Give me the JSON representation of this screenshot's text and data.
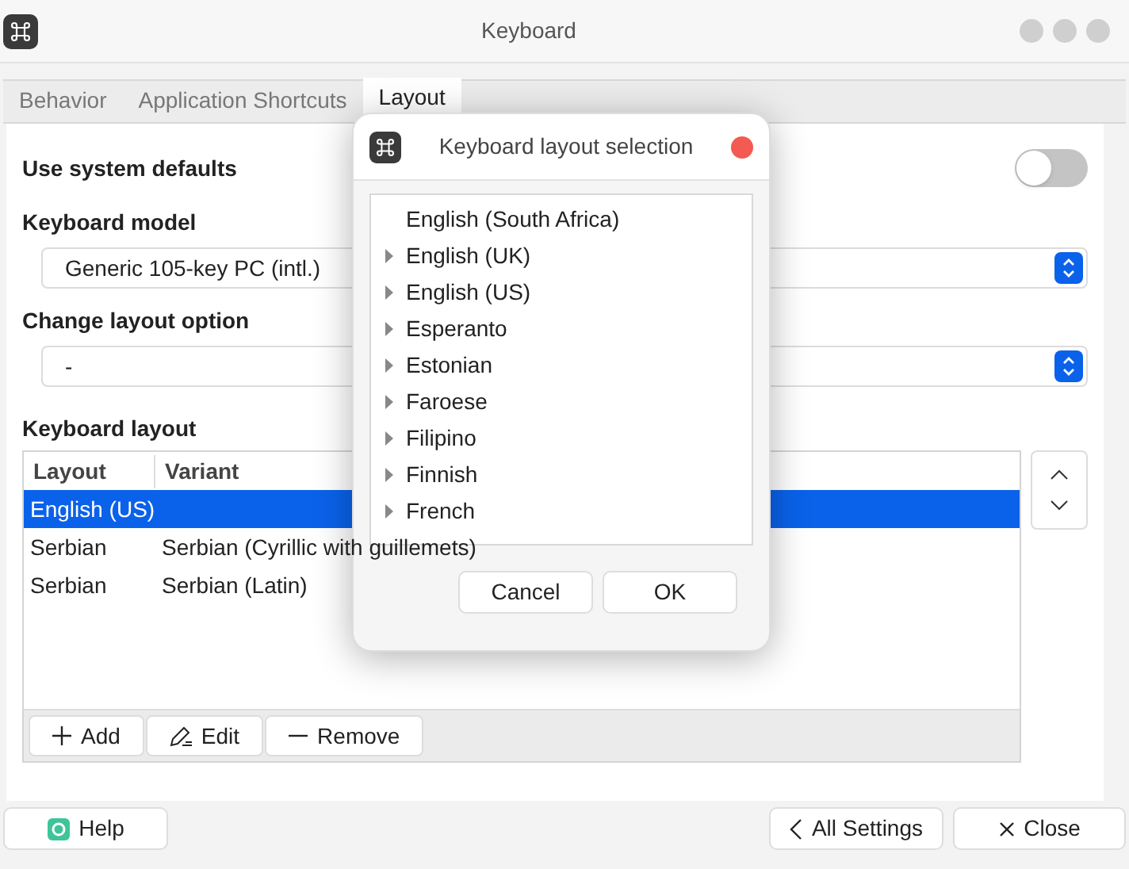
{
  "window": {
    "title": "Keyboard"
  },
  "tabs": [
    {
      "label": "Behavior",
      "selected": false
    },
    {
      "label": "Application Shortcuts",
      "selected": false
    },
    {
      "label": "Layout",
      "selected": true
    }
  ],
  "system_defaults": {
    "label": "Use system defaults",
    "on": false
  },
  "keyboard_model": {
    "label": "Keyboard model",
    "value": "Generic 105-key PC (intl.)"
  },
  "layout_option": {
    "label": "Change layout option",
    "value": "-"
  },
  "keyboard_layout": {
    "label": "Keyboard layout",
    "columns": [
      "Layout",
      "Variant"
    ],
    "rows": [
      {
        "layout": "English (US)",
        "variant": "",
        "selected": true
      },
      {
        "layout": "Serbian",
        "variant": "Serbian (Cyrillic with guillemets)",
        "selected": false
      },
      {
        "layout": "Serbian",
        "variant": "Serbian (Latin)",
        "selected": false
      }
    ],
    "buttons": [
      {
        "label": "Add",
        "kind": "add"
      },
      {
        "label": "Edit",
        "kind": "edit"
      },
      {
        "label": "Remove",
        "kind": "remove"
      }
    ]
  },
  "footer": [
    {
      "label": "Help",
      "kind": "help"
    },
    {
      "label": "All Settings",
      "kind": "back"
    },
    {
      "label": "Close",
      "kind": "close"
    }
  ],
  "dialog": {
    "title": "Keyboard layout selection",
    "items": [
      {
        "label": "English (South Africa)",
        "expandable": false
      },
      {
        "label": "English (UK)",
        "expandable": true
      },
      {
        "label": "English (US)",
        "expandable": true
      },
      {
        "label": "Esperanto",
        "expandable": true
      },
      {
        "label": "Estonian",
        "expandable": true
      },
      {
        "label": "Faroese",
        "expandable": true
      },
      {
        "label": "Filipino",
        "expandable": true
      },
      {
        "label": "Finnish",
        "expandable": true
      },
      {
        "label": "French",
        "expandable": true
      }
    ],
    "buttons": [
      "Cancel",
      "OK"
    ]
  }
}
